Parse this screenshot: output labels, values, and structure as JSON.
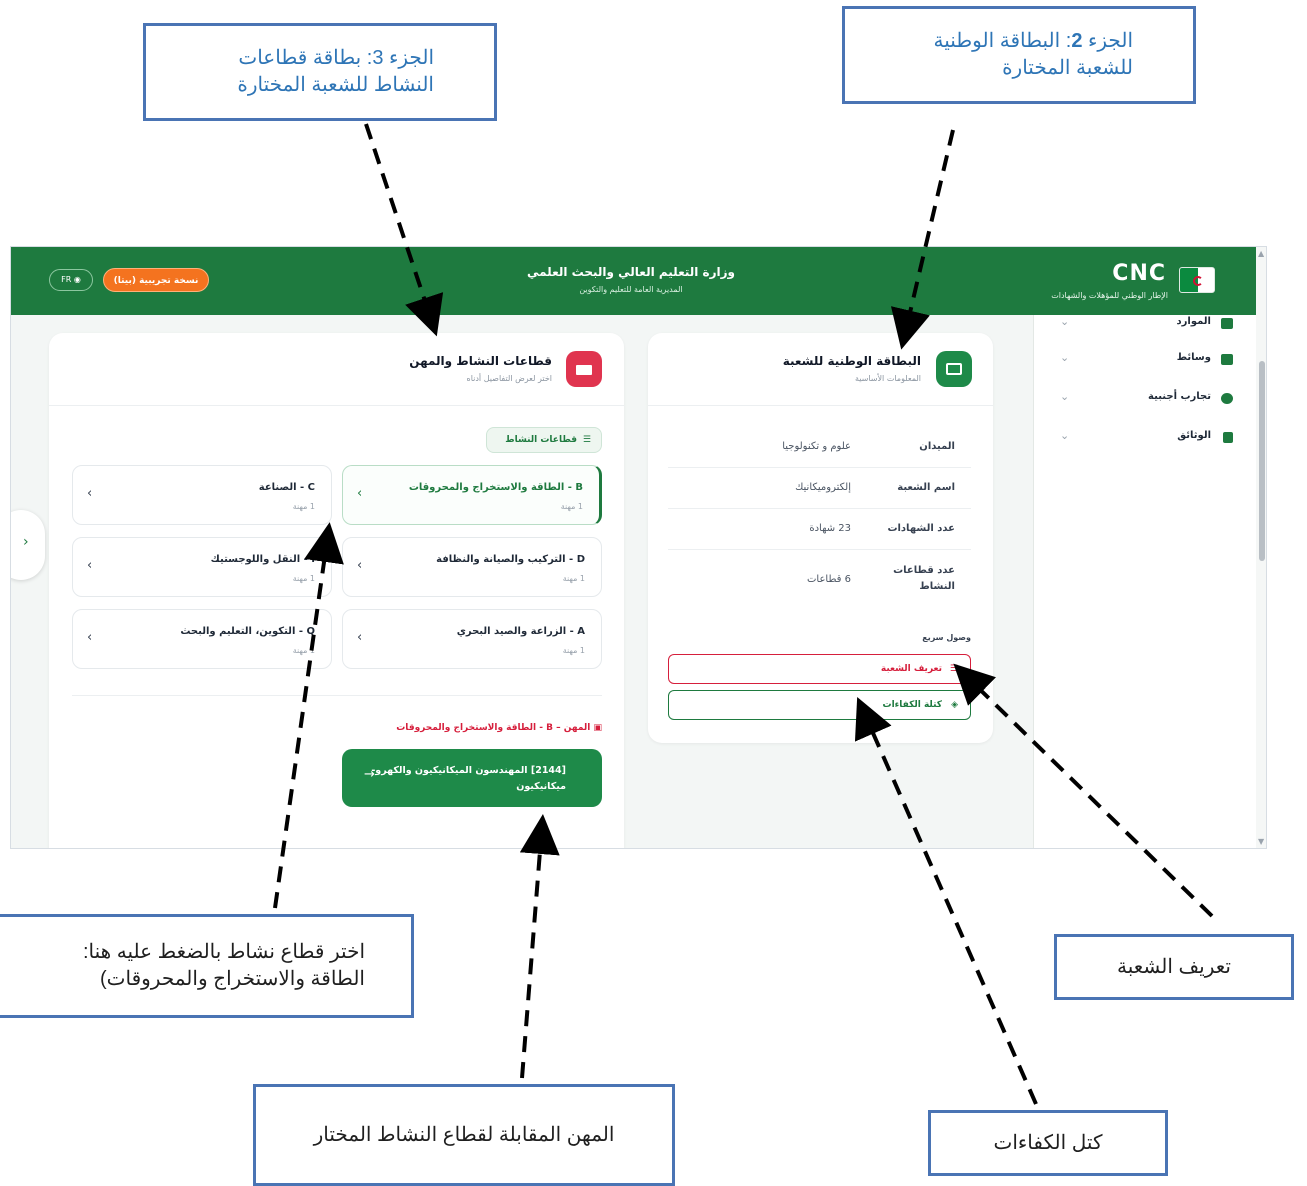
{
  "callouts": {
    "part3": {
      "l1": "الجزء 3: بطاقة قطاعات",
      "l2": "النشاط للشعبة المختارة"
    },
    "part2": {
      "prefix": "الجزء ",
      "num": "2",
      "rest": ": البطاقة الوطنية",
      "l2": "للشعبة المختارة"
    },
    "select_sector": {
      "l1": "اختر قطاع نشاط بالضغط عليه هنا:",
      "l2": "الطاقة والاستخراج والمحروقات)"
    },
    "professions": "المهن المقابلة لقطاع النشاط المختار",
    "competencies": "كتل الكفاءات",
    "definition": "تعريف الشعبة"
  },
  "header": {
    "brand": "CNC",
    "brand_sub": "الإطار الوطني للمؤهلات والشهادات",
    "ministry": "وزارة التعليم العالي والبحث العلمي",
    "directorate": "المديرية العامة للتعليم والتكوين",
    "beta_badge": "نسخة تجريبية (بيتا)",
    "lang": "FR"
  },
  "sidebar": {
    "items": [
      {
        "label": "الموارد",
        "icon": "book-icon"
      },
      {
        "label": "وسائط",
        "icon": "media-icon"
      },
      {
        "label": "تجارب أجنبية",
        "icon": "globe-icon"
      },
      {
        "label": "الوثائق",
        "icon": "document-icon"
      }
    ]
  },
  "national_card": {
    "title": "البطاقة الوطنية للشعبة",
    "subtitle": "المعلومات الأساسية",
    "rows": [
      {
        "key": "الميدان",
        "value": "علوم و تكنولوجيا"
      },
      {
        "key": "اسم الشعبة",
        "value": "إلكتروميكانيك"
      },
      {
        "key": "عدد الشهادات",
        "value": "23 شهادة"
      },
      {
        "key": "عدد قطاعات النشاط",
        "value": "6 قطاعات"
      }
    ],
    "quick_access": "وصول سريع",
    "quick_definition": "تعريف الشعبة",
    "quick_competencies": "كتلة الكفاءات",
    "colors": {
      "definition": "#d61f3c",
      "competencies": "#1e7a3f"
    }
  },
  "sectors_card": {
    "title": "قطاعات النشاط والمهن",
    "subtitle": "اختر لعرض التفاصيل أدناه",
    "chip": "قطاعات النشاط",
    "sectors": [
      {
        "name": "B - الطاقة والاستخراج والمحروقات",
        "count": "1 مهنة",
        "active": true
      },
      {
        "name": "C - الصناعة",
        "count": "1 مهنة",
        "active": false
      },
      {
        "name": "D - التركيب والصيانة والنظافة",
        "count": "1 مهنة",
        "active": false
      },
      {
        "name": "I - النقل واللوجستيك",
        "count": "1 مهنة",
        "active": false
      },
      {
        "name": "A - الزراعة والصيد البحري",
        "count": "1 مهنة",
        "active": false
      },
      {
        "name": "Q - التكوين، التعليم والبحث",
        "count": "1 مهنة",
        "active": false
      }
    ],
    "professions_head": "المهن – B - الطاقة والاستخراج والمحروقات",
    "profession": "[2144] المهندسون الميكانيكيون والكهرو-ميكانيكيون"
  },
  "colors": {
    "primary": "#1e7a3f",
    "accent_orange": "#f4731f",
    "danger": "#d61f3c",
    "callout_border": "#4a74b4"
  }
}
